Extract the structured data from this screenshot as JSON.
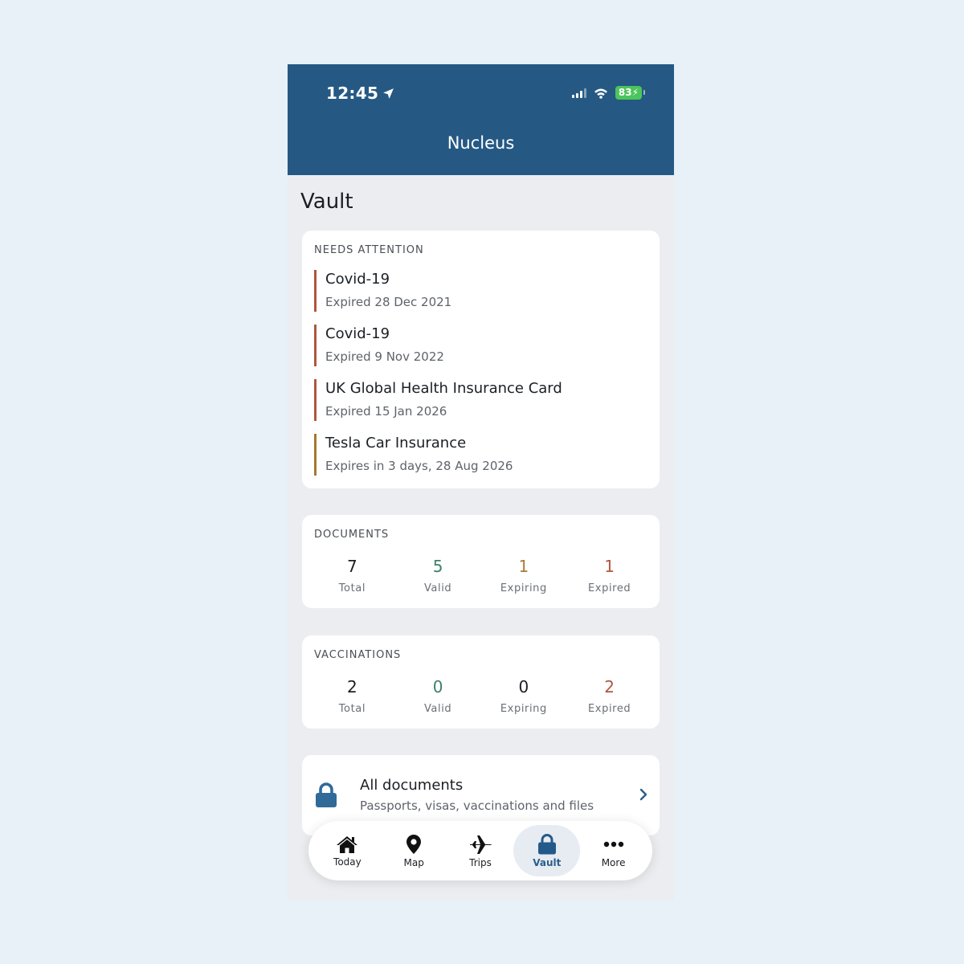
{
  "status_bar": {
    "time": "12:45",
    "battery": "83"
  },
  "header": {
    "title": "Nucleus"
  },
  "page": {
    "title": "Vault"
  },
  "needs_attention": {
    "label": "NEEDS ATTENTION",
    "items": [
      {
        "title": "Covid-19",
        "subtitle": "Expired 28 Dec 2021",
        "status": "expired"
      },
      {
        "title": "Covid-19",
        "subtitle": "Expired 9 Nov 2022",
        "status": "expired"
      },
      {
        "title": "UK Global Health Insurance Card",
        "subtitle": "Expired 15 Jan 2026",
        "status": "expired"
      },
      {
        "title": "Tesla Car Insurance",
        "subtitle": "Expires in 3 days, 28 Aug 2026",
        "status": "expiring"
      }
    ]
  },
  "documents": {
    "label": "DOCUMENTS",
    "stats": [
      {
        "value": "7",
        "label": "Total"
      },
      {
        "value": "5",
        "label": "Valid"
      },
      {
        "value": "1",
        "label": "Expiring"
      },
      {
        "value": "1",
        "label": "Expired"
      }
    ]
  },
  "vaccinations": {
    "label": "VACCINATIONS",
    "stats": [
      {
        "value": "2",
        "label": "Total"
      },
      {
        "value": "0",
        "label": "Valid"
      },
      {
        "value": "0",
        "label": "Expiring"
      },
      {
        "value": "2",
        "label": "Expired"
      }
    ]
  },
  "all_documents": {
    "title": "All documents",
    "subtitle": "Passports, visas, vaccinations and files"
  },
  "tabs": [
    {
      "label": "Today",
      "icon": "home-icon"
    },
    {
      "label": "Map",
      "icon": "map-pin-icon"
    },
    {
      "label": "Trips",
      "icon": "airplane-icon"
    },
    {
      "label": "Vault",
      "icon": "lock-icon",
      "active": true
    },
    {
      "label": "More",
      "icon": "more-icon"
    }
  ],
  "colors": {
    "header": "#255984",
    "expired": "#b0573e",
    "expiring": "#a87c36",
    "valid": "#3e7f6b",
    "lock": "#2f6a99"
  }
}
